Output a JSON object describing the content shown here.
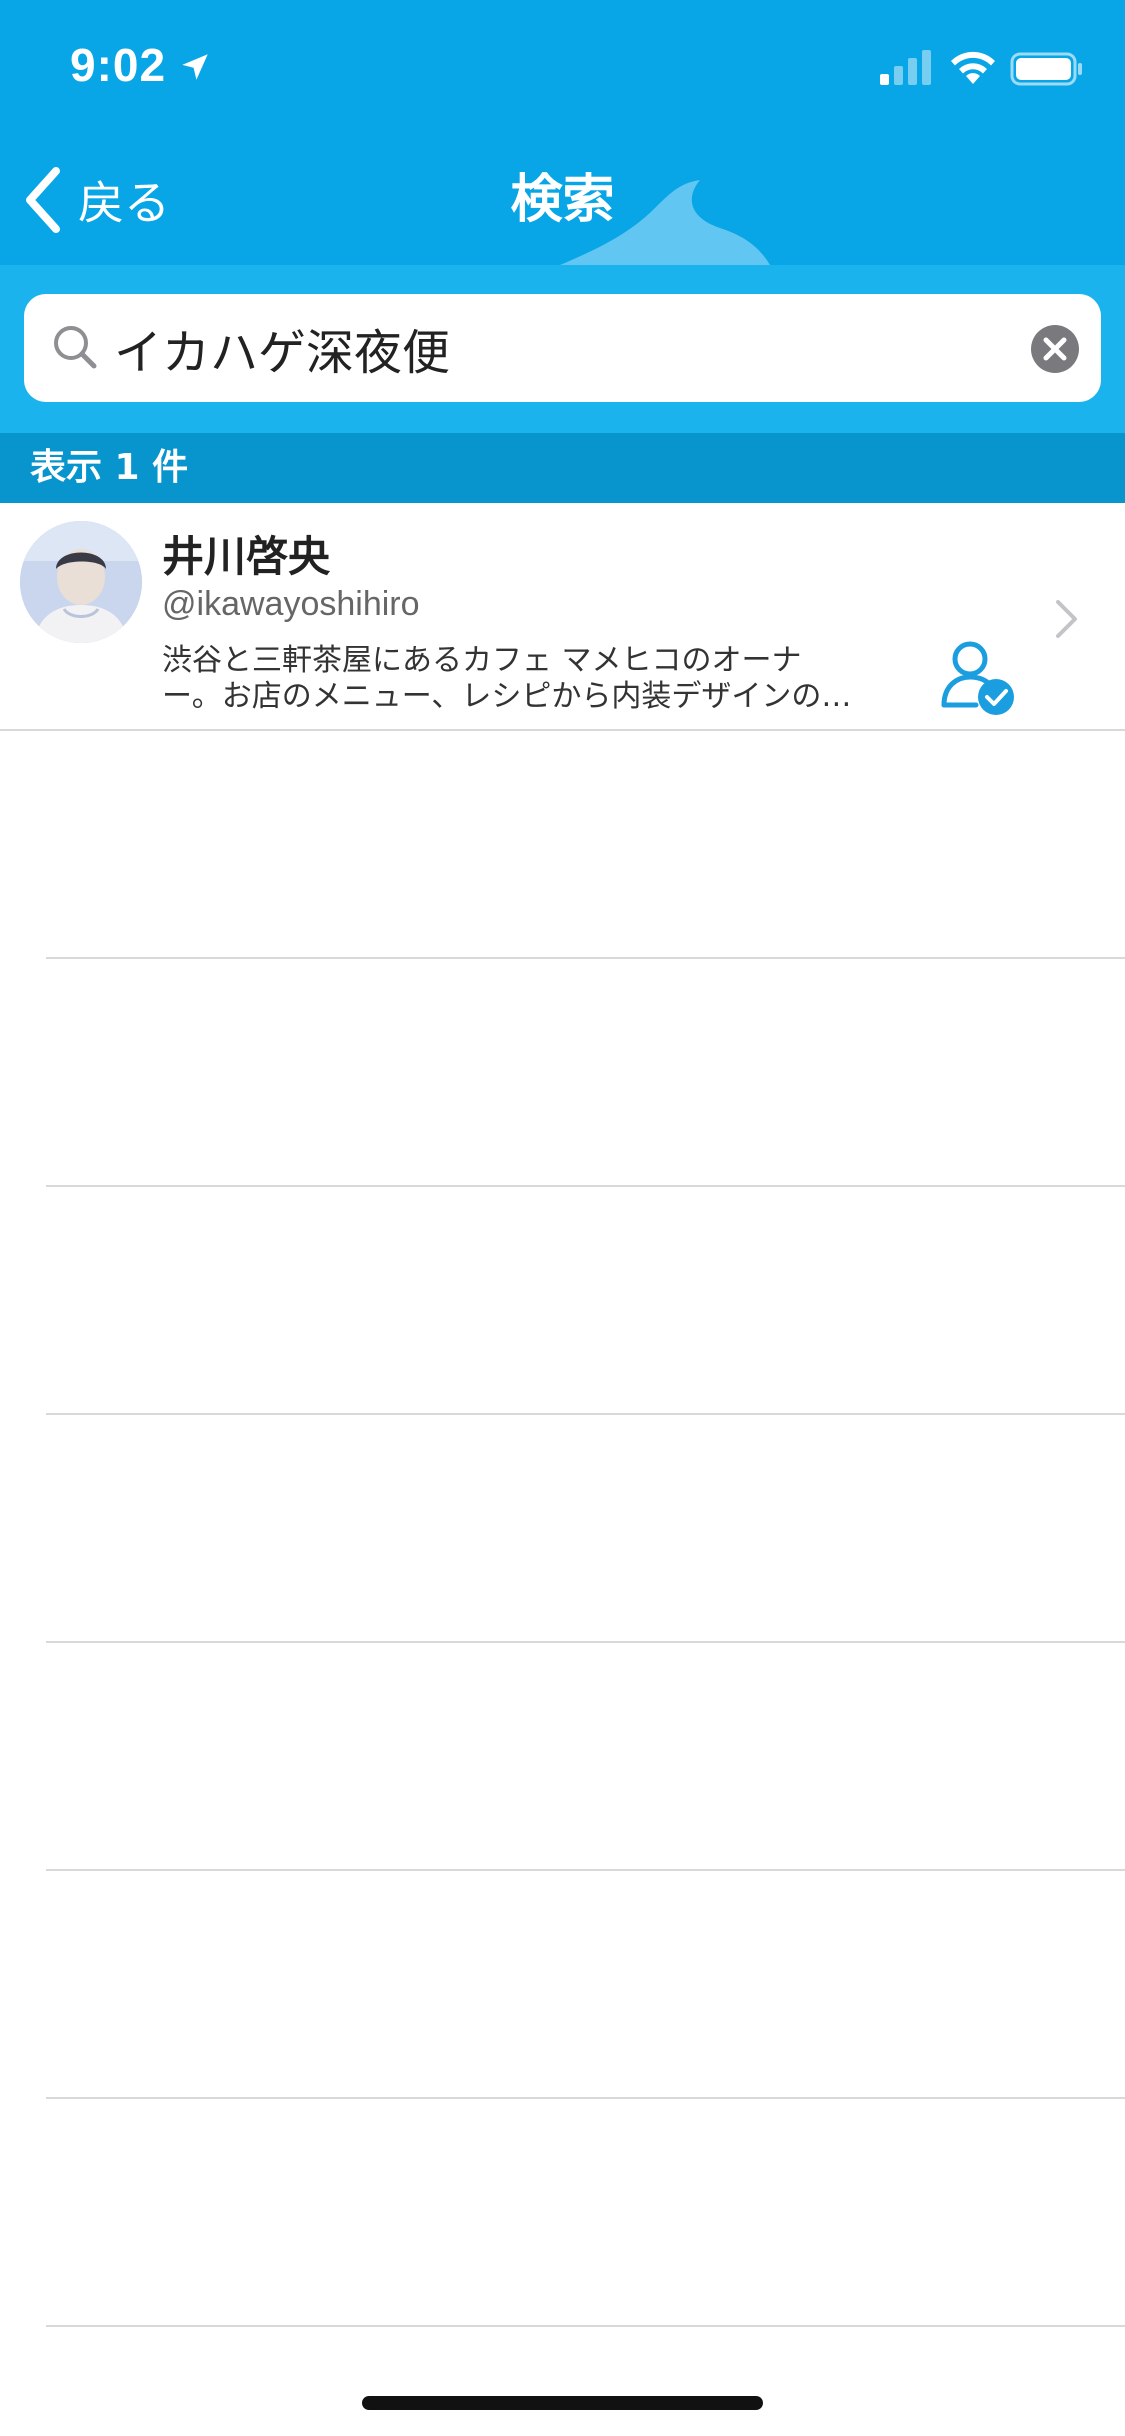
{
  "status_bar": {
    "time": "9:02"
  },
  "nav": {
    "back_label": "戻る",
    "title": "検索"
  },
  "search": {
    "query": "イカハゲ深夜便",
    "placeholder": ""
  },
  "results": {
    "count_label": "表示 1 件",
    "items": [
      {
        "name": "井川啓央",
        "handle": "@ikawayoshihiro",
        "bio_line1": "渋谷と三軒茶屋にあるカフェ マメヒコのオーナ",
        "bio_line2": "ー。お店のメニュー、レシピから内装デザインの…",
        "follow_icon": "user-verified-icon"
      }
    ]
  },
  "colors": {
    "header": "#08a6e6",
    "search_band": "#1bb3ee",
    "count_bar": "#0894cd",
    "accent": "#1a9ee0"
  }
}
